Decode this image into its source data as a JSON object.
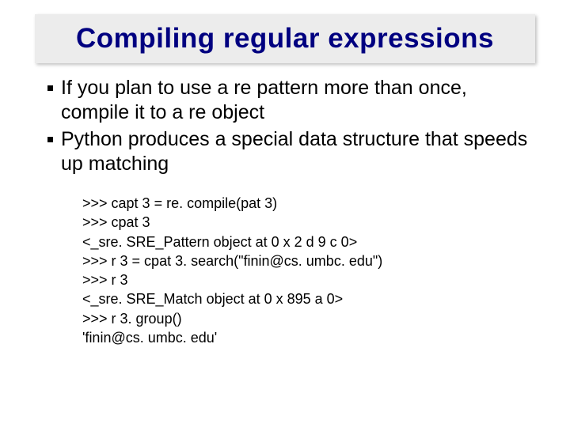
{
  "title": "Compiling regular expressions",
  "bullets": [
    "If you plan to use a re pattern more than once, compile it to a re object",
    "Python produces a special data structure that speeds up matching"
  ],
  "code": [
    ">>> capt 3 = re. compile(pat 3)",
    ">>> cpat 3",
    "<_sre. SRE_Pattern object at 0 x 2 d 9 c 0>",
    ">>> r 3 = cpat 3. search(\"finin@cs. umbc. edu\")",
    ">>> r 3",
    "<_sre. SRE_Match object at 0 x 895 a 0>",
    ">>> r 3. group()",
    "'finin@cs. umbc. edu'"
  ]
}
